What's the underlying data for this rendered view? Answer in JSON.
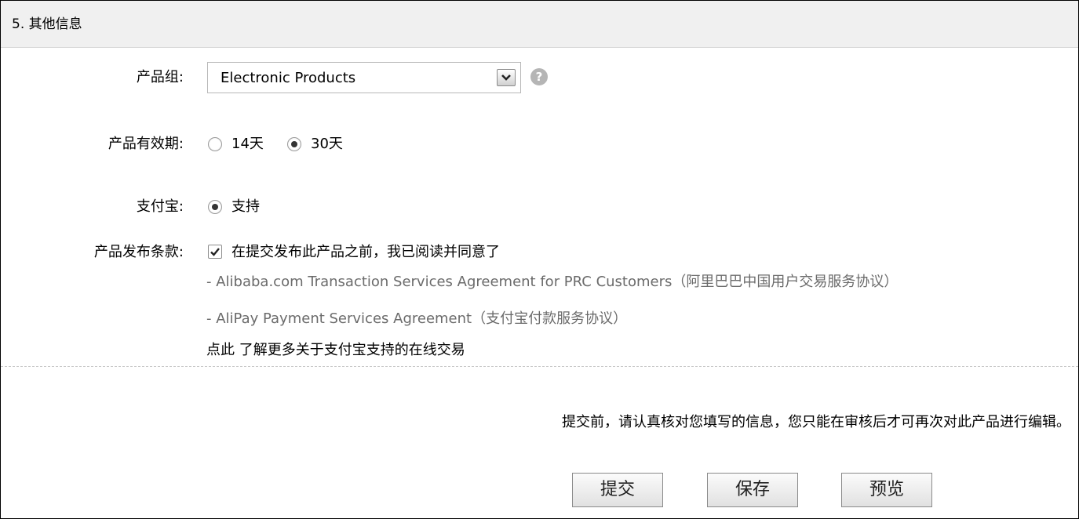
{
  "section": {
    "title": "5. 其他信息"
  },
  "product_group": {
    "label": "产品组:",
    "selected": "Electronic Products",
    "help": "?"
  },
  "validity": {
    "label": "产品有效期:",
    "options": [
      {
        "label": "14天",
        "checked": false
      },
      {
        "label": "30天",
        "checked": true
      }
    ]
  },
  "alipay": {
    "label": "支付宝:",
    "option": "支持",
    "checked": true
  },
  "terms": {
    "label": "产品发布条款:",
    "checkbox_label": "在提交发布此产品之前，我已阅读并同意了",
    "checked": true,
    "agreement1": "- Alibaba.com Transaction Services Agreement for PRC Customers（阿里巴巴中国用户交易服务协议）",
    "agreement2": "- AliPay Payment Services Agreement（支付宝付款服务协议）",
    "more": "点此 了解更多关于支付宝支持的在线交易"
  },
  "notice": "提交前，请认真核对您填写的信息，您只能在审核后才可再次对此产品进行编辑。",
  "buttons": {
    "submit": "提交",
    "save": "保存",
    "preview": "预览"
  }
}
